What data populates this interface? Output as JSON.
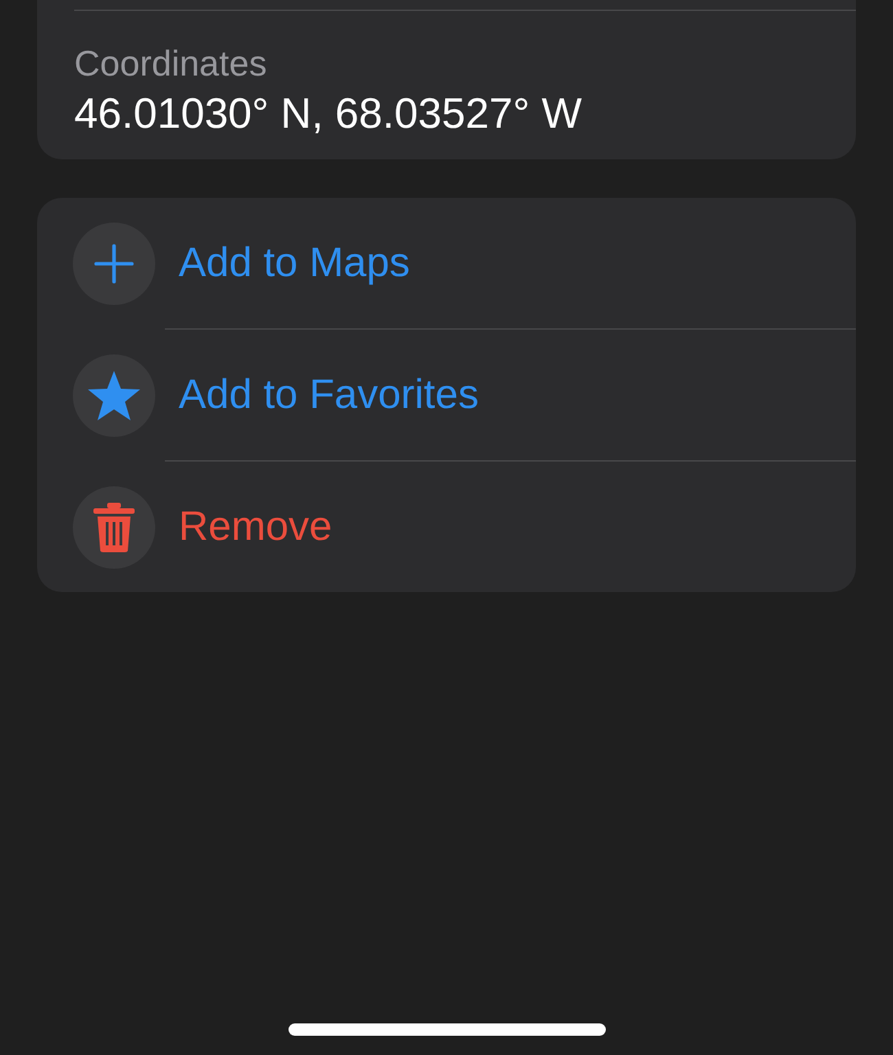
{
  "details": {
    "label": "Coordinates",
    "value": "46.01030° N, 68.03527° W"
  },
  "actions": [
    {
      "kind": "add",
      "label": "Add to Maps",
      "color": "#2f8ff0"
    },
    {
      "kind": "favorite",
      "label": "Add to Favorites",
      "color": "#2f8ff0"
    },
    {
      "kind": "remove",
      "label": "Remove",
      "color": "#eb4d3d"
    }
  ]
}
